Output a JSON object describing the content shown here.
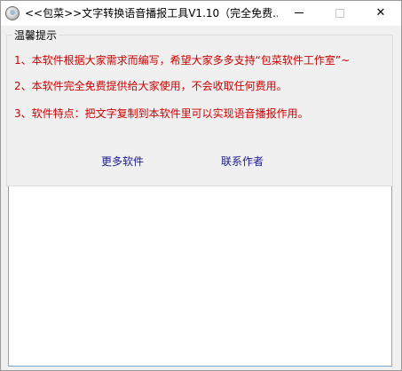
{
  "window": {
    "title": "<<包菜>>文字转换语音播报工具V1.10（完全免费...",
    "minimize_glyph": "—",
    "maximize_glyph": "□",
    "close_glyph": "✕"
  },
  "notice": {
    "legend": "温馨提示",
    "line1": "1、本软件根据大家需求而编写，希望大家多多支持“包菜软件工作室”~",
    "line2": "2、本软件完全免费提供给大家使用，不会收取任何费用。",
    "line3": "3、软件特点：把文字复制到本软件里可以实现语音播报作用。",
    "link_more": "更多软件",
    "link_contact": "联系作者"
  },
  "text_input": {
    "value": ""
  },
  "colors": {
    "notice_text": "#cc0000",
    "link_text": "#1a1a8e",
    "input_border": "#7aa7d6"
  },
  "icons": {
    "app": "app-globe-icon"
  }
}
